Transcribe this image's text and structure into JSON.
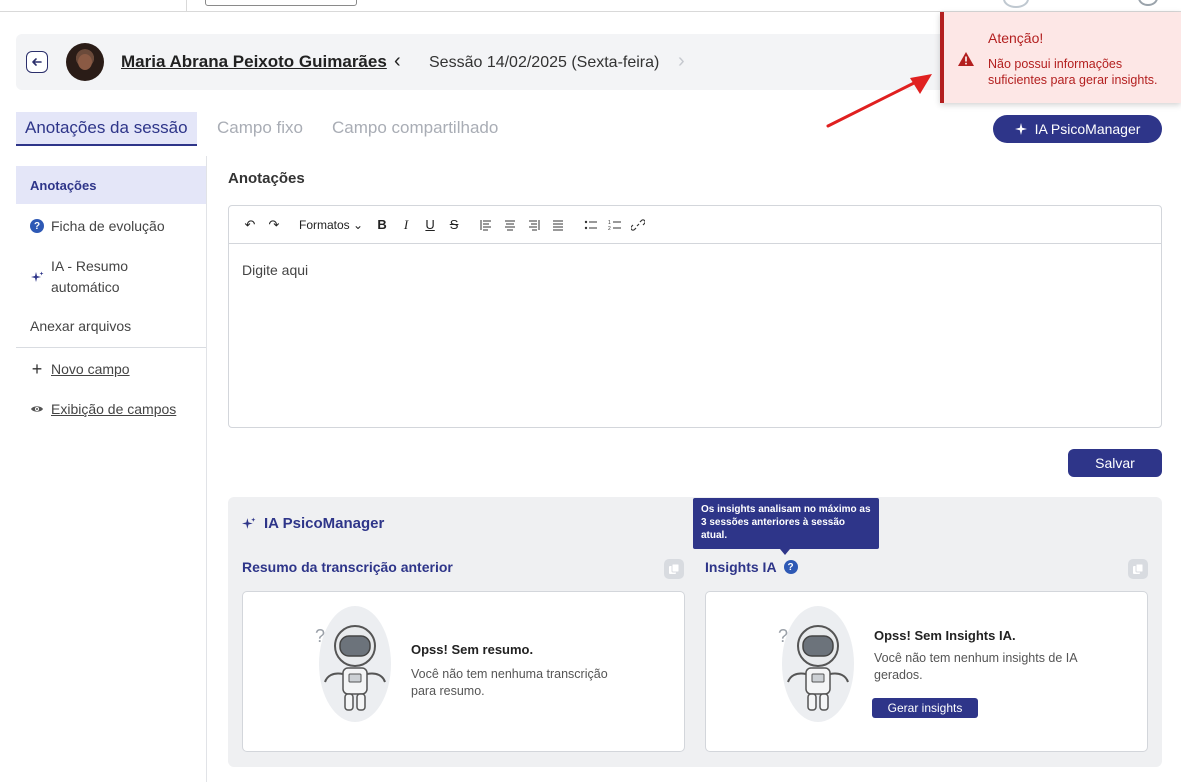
{
  "patient": {
    "name": "Maria Abrana Peixoto Guimarães",
    "session_label": "Sessão 14/02/2025 (Sexta-feira)"
  },
  "tabs": [
    {
      "label": "Anotações da sessão"
    },
    {
      "label": "Campo fixo"
    },
    {
      "label": "Campo compartilhado"
    }
  ],
  "header_actions": {
    "ia_button_label": "IA PsicoManager"
  },
  "sidebar": {
    "items": [
      {
        "label": "Anotações"
      },
      {
        "label": "Ficha de evolução"
      },
      {
        "label": "IA - Resumo automático"
      },
      {
        "label": "Anexar arquivos"
      },
      {
        "label": "Novo campo"
      },
      {
        "label": "Exibição de campos"
      }
    ]
  },
  "editor": {
    "section_title": "Anotações",
    "formats_label": "Formatos",
    "placeholder": "Digite aqui",
    "save_label": "Salvar"
  },
  "ia_panel": {
    "title": "IA PsicoManager",
    "summary": {
      "title": "Resumo da transcrição anterior",
      "empty_title": "Opss! Sem resumo.",
      "empty_text": "Você não tem nenhuma transcrição para resumo."
    },
    "insights": {
      "title": "Insights IA",
      "empty_title": "Opss! Sem Insights IA.",
      "empty_text": "Você não tem nenhum insights de IA gerados.",
      "button_label": "Gerar insights"
    },
    "tooltip": "Os insights analisam no máximo as 3 sessões anteriores à sessão atual."
  },
  "toast": {
    "title": "Atenção!",
    "message": "Não possui informações suficientes para gerar insights."
  },
  "colors": {
    "primary": "#2e3589",
    "danger": "#b31f1f",
    "toast_bg": "#fde7e6",
    "panel_bg": "#eff0f2"
  }
}
